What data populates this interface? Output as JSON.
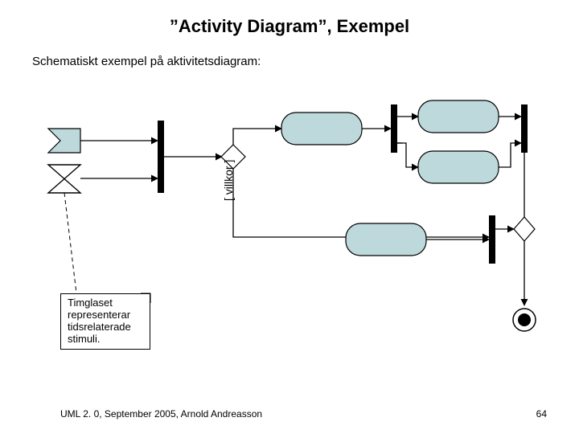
{
  "title": "”Activity Diagram”, Exempel",
  "subtitle": "Schematiskt exempel på aktivitetsdiagram:",
  "guard_label": "[ villkor ]",
  "note": {
    "line1": "Timglaset",
    "line2": "representerar",
    "line3": "tidsrelaterade",
    "line4": "stimuli."
  },
  "footer": {
    "left": "UML 2. 0, September 2005, Arnold Andreasson",
    "page": "64"
  },
  "colors": {
    "activity_fill": "#bed9db",
    "stroke": "#000000"
  }
}
